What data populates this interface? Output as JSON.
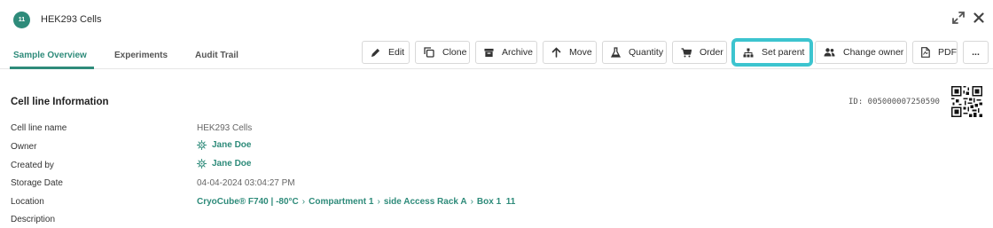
{
  "header": {
    "badge_text": "11",
    "title": "HEK293 Cells"
  },
  "tabs": [
    {
      "label": "Sample Overview",
      "active": true
    },
    {
      "label": "Experiments",
      "active": false
    },
    {
      "label": "Audit Trail",
      "active": false
    }
  ],
  "toolbar": {
    "edit": "Edit",
    "clone": "Clone",
    "archive": "Archive",
    "move": "Move",
    "quantity": "Quantity",
    "order": "Order",
    "set_parent": "Set parent",
    "change_owner": "Change owner",
    "pdf": "PDF",
    "more": "..."
  },
  "section": {
    "title": "Cell line Information",
    "id_text": "ID: 005000007250590"
  },
  "fields": {
    "name_label": "Cell line name",
    "name_value": "HEK293 Cells",
    "owner_label": "Owner",
    "owner_value": "Jane Doe",
    "created_label": "Created by",
    "created_value": "Jane Doe",
    "storage_label": "Storage Date",
    "storage_value": "04-04-2024 03:04:27 PM",
    "location_label": "Location",
    "location_path": [
      "CryoCube® F740 | -80°C",
      "Compartment 1",
      "side Access Rack A",
      "Box 1  11"
    ],
    "description_label": "Description"
  },
  "colors": {
    "accent": "#2e8b7a",
    "highlight": "#3cc4cf"
  },
  "icons": [
    "expand-icon",
    "close-icon",
    "pencil-icon",
    "clone-icon",
    "archive-icon",
    "arrow-up-icon",
    "flask-icon",
    "cart-icon",
    "hierarchy-icon",
    "users-icon",
    "pdf-icon",
    "user-avatar-icon",
    "qr-code-icon"
  ]
}
